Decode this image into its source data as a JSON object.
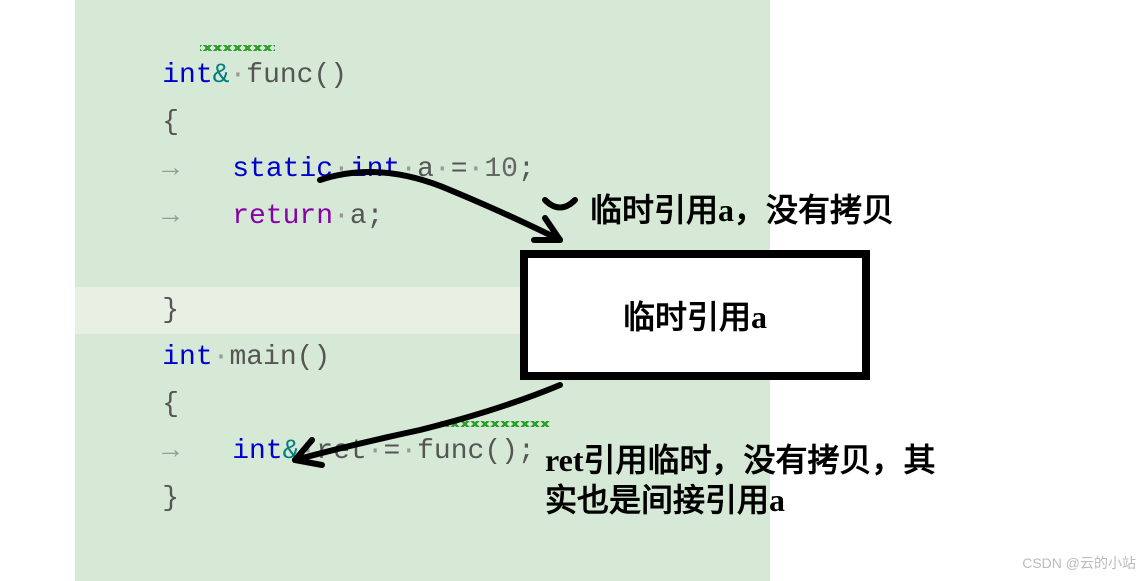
{
  "code": {
    "line1": {
      "int": "int",
      "amp": "&",
      "dot1": "·",
      "func": "func",
      "parens": "()"
    },
    "line2": {
      "brace": "{"
    },
    "line3": {
      "arrow": "→",
      "static": "static",
      "dot1": "·",
      "int": "int",
      "dot2": "·",
      "a": "a",
      "dot3": "·",
      "eq": "=",
      "dot4": "·",
      "val": "10",
      "semi": ";"
    },
    "line4": {
      "arrow": "→",
      "return": "return",
      "dot1": "·",
      "a": "a",
      "semi": ";"
    },
    "line5": {
      "brace": "}"
    },
    "line6": {
      "blank": ""
    },
    "line7": {
      "int": "int",
      "dot1": "·",
      "main": "main",
      "parens": "()"
    },
    "line8": {
      "brace": "{"
    },
    "line9": {
      "arrow": "→",
      "int": "int",
      "amp": "&",
      "dot1": "·",
      "ret": "ret",
      "dot2": "·",
      "eq": "=",
      "dot3": "·",
      "func": "func",
      "parens": "()",
      "semi": ";"
    },
    "line10": {
      "brace": "}"
    }
  },
  "annotations": {
    "top_right": "临时引用a，没有拷贝",
    "box_text": "临时引用a",
    "bottom_line1": "ret引用临时，没有拷贝，其",
    "bottom_line2": "实也是间接引用a"
  },
  "watermark": "CSDN @云的小站"
}
